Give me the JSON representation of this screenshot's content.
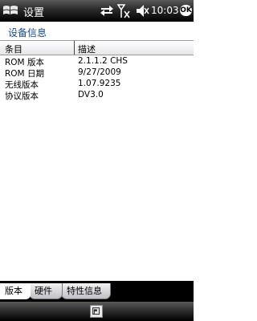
{
  "titlebar": {
    "title": "设置",
    "clock": "10:03",
    "ok_label": "OK"
  },
  "section_title": "设备信息",
  "table": {
    "headers": [
      "条目",
      "描述"
    ],
    "rows": [
      {
        "item": "ROM 版本",
        "desc": "2.1.1.2 CHS"
      },
      {
        "item": "ROM 日期",
        "desc": "9/27/2009"
      },
      {
        "item": "无线版本",
        "desc": "1.07.9235"
      },
      {
        "item": "协议版本",
        "desc": "DV3.0"
      }
    ]
  },
  "tabs": [
    {
      "label": "版本",
      "active": true
    },
    {
      "label": "硬件",
      "active": false
    },
    {
      "label": "特性信息",
      "active": false
    }
  ],
  "icons": {
    "start": "windows-flag-icon",
    "sync": "sync-icon",
    "signal": "signal-icon",
    "volume": "volume-icon",
    "keyboard": "keyboard-icon"
  }
}
